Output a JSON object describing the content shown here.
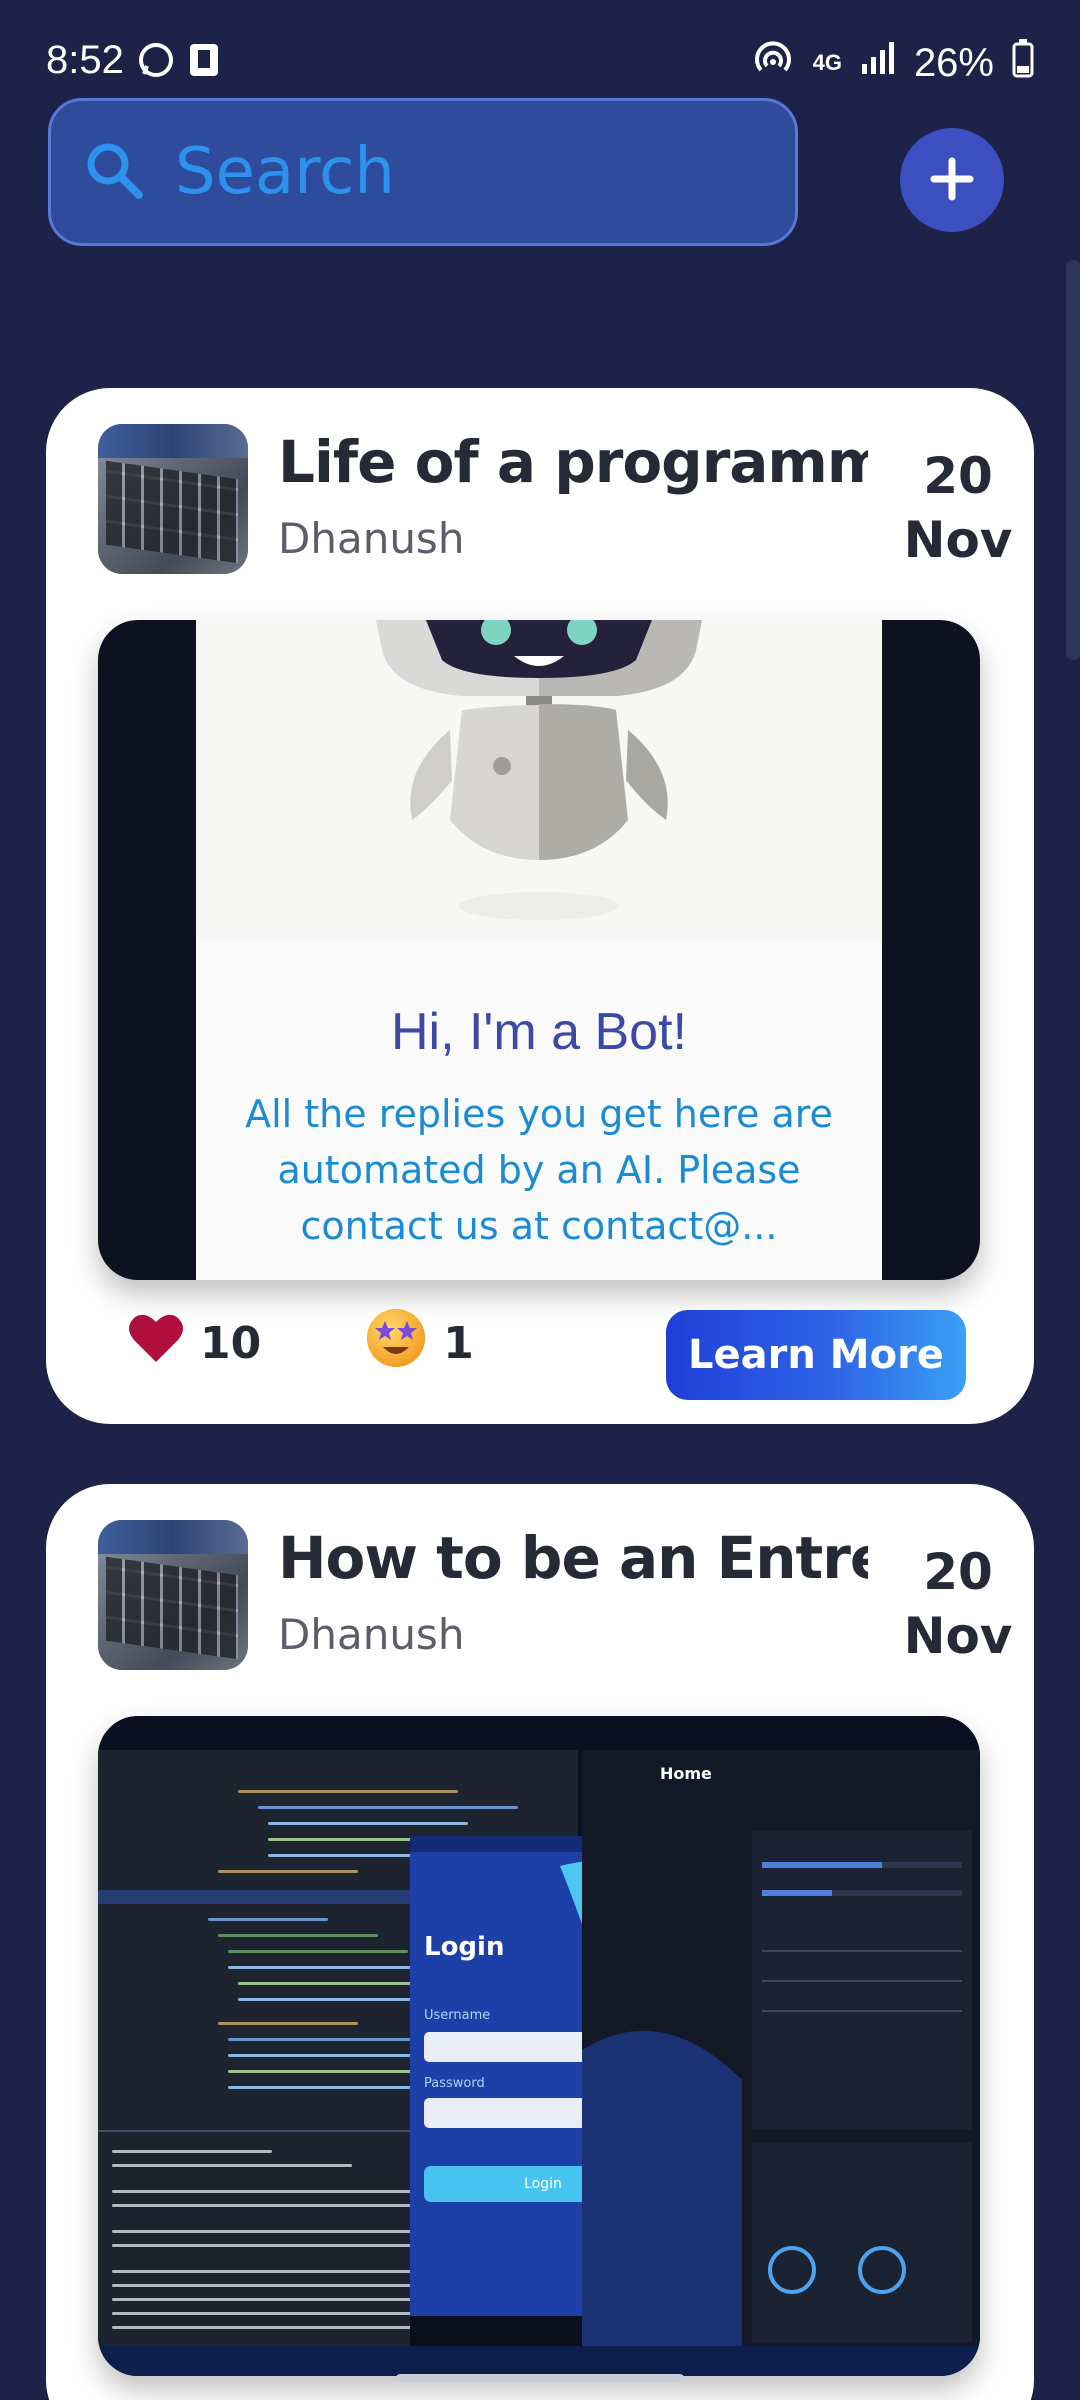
{
  "status_bar": {
    "time": "8:52",
    "network": "4G",
    "battery": "26%"
  },
  "search": {
    "placeholder": "Search"
  },
  "colors": {
    "background": "#1d2348",
    "accent": "#3c4fc0",
    "search_text": "#2b93ee",
    "heart": "#b00e3c"
  },
  "posts": [
    {
      "title": "Life of a programmer",
      "author": "Dhanush",
      "date_day": "20",
      "date_month": "Nov",
      "image": {
        "headline": "Hi, I'm a Bot!",
        "body": "All the replies you get here are automated by an AI. Please contact us at contact@..."
      },
      "likes": "10",
      "star_reactions": "1",
      "button_label": "Learn More"
    },
    {
      "title": "How to be an Entrepreneur",
      "author": "Dhanush",
      "date_day": "20",
      "date_month": "Nov",
      "image": {
        "app_title": "Login",
        "username_label": "Username",
        "password_label": "Password",
        "login_button": "Login",
        "home_label": "Home"
      }
    }
  ]
}
